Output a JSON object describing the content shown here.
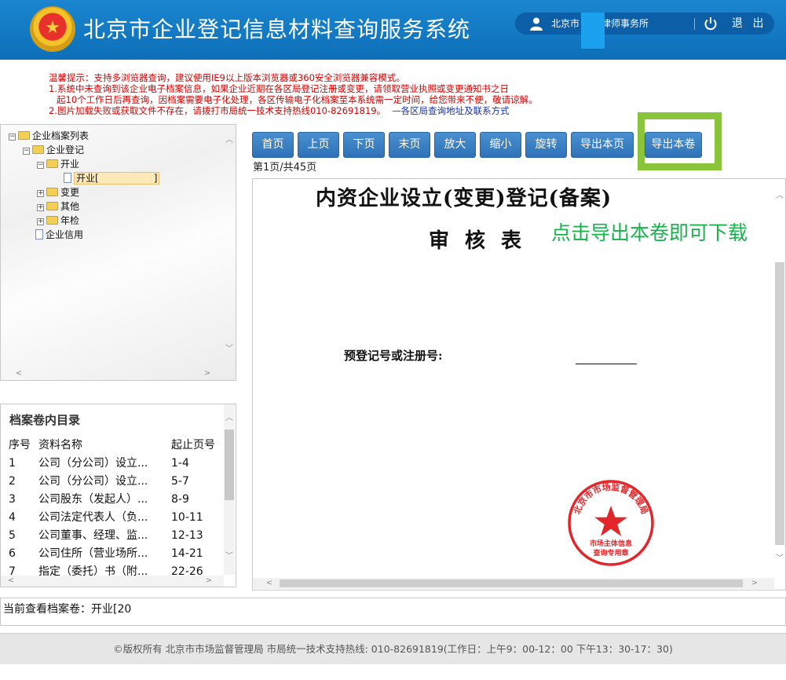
{
  "header": {
    "title": "北京市企业登记信息材料查询服务系统",
    "user_name": "北京市",
    "user_name_suffix": "律师事务所",
    "logout_label": "退 出",
    "emblem_glyph": "★"
  },
  "notice": {
    "line1": "温馨提示：支持多浏览器查询，建议使用IE9以上版本浏览器或360安全浏览器兼容模式。",
    "line2": "1.系统中未查询到该企业电子档案信息，如果企业近期在各区局登记注册或变更，请领取营业执照或变更通知书之日",
    "line3": "起10个工作日后再查询，因档案需要电子化处理，各区传输电子化档案至本系统需一定时间，给您带来不便，敬请谅解。",
    "line4": "2.图片加载失败或获取文件不存在，请拨打市局统一技术支持热线010-82691819。",
    "link": "—各区局查询地址及联系方式"
  },
  "tree": {
    "root": "企业档案列表",
    "registration": "企业登记",
    "opening": "开业",
    "opening_leaf": "开业[",
    "opening_leaf_end": "]",
    "change": "变更",
    "other": "其他",
    "annual": "年检",
    "credit": "企业信用"
  },
  "catalog": {
    "title": "档案卷内目录",
    "headers": [
      "序号",
      "资料名称",
      "起止页号"
    ],
    "rows": [
      [
        "1",
        "公司（分公司）设立...",
        "1-4"
      ],
      [
        "2",
        "公司（分公司）设立...",
        "5-7"
      ],
      [
        "3",
        "公司股东（发起人）...",
        "8-9"
      ],
      [
        "4",
        "公司法定代表人（负...",
        "10-11"
      ],
      [
        "5",
        "公司董事、经理、监...",
        "12-13"
      ],
      [
        "6",
        "公司住所（营业场所...",
        "14-21"
      ],
      [
        "7",
        "指定（委托）书（附...",
        "22-26"
      ]
    ]
  },
  "toolbar": {
    "first": "首页",
    "prev": "上页",
    "next": "下页",
    "last": "末页",
    "zoom_in": "放大",
    "zoom_out": "缩小",
    "rotate": "旋转",
    "export_page": "导出本页",
    "export_volume": "导出本卷"
  },
  "page_info": "第1页/共45页",
  "document": {
    "title": "内资企业设立(变更)登记(备案)",
    "subtitle": "审核表",
    "annotation": "点击导出本卷即可下载",
    "reg_label": "预登记号或注册号:",
    "seal_text_top": "北京市市场监督管理局",
    "seal_text_bottom1": "市场主体信息",
    "seal_text_bottom2": "查询专用章"
  },
  "status": {
    "text": "当前查看档案卷：开业[20"
  },
  "footer": {
    "text": "©版权所有 北京市市场监督管理局   市局统一技术支持热线: 010-82691819(工作日：上午9：00-12：00 下午13：30-17：30)"
  },
  "colors": {
    "header_blue": "#0d6fb8",
    "button_blue": "#2f72b8",
    "notice_red": "#d40000",
    "annotation_green": "#19b24d",
    "highlight_green": "#8ac43a",
    "seal_red": "#e2262a"
  }
}
